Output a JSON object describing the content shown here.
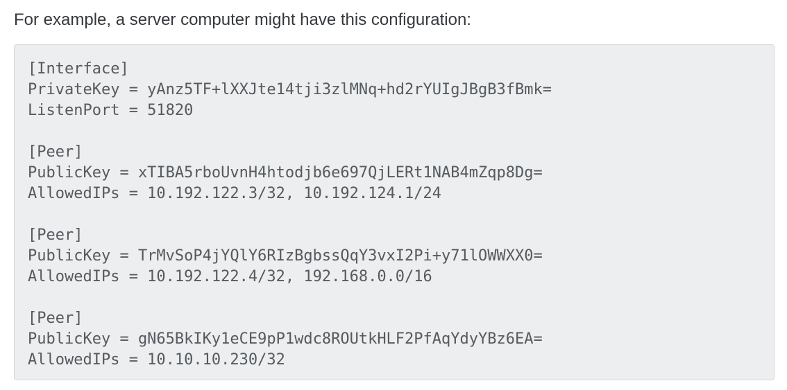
{
  "intro_text": "For example, a server computer might have this configuration:",
  "config": {
    "interface": {
      "header": "[Interface]",
      "lines": [
        "PrivateKey = yAnz5TF+lXXJte14tji3zlMNq+hd2rYUIgJBgB3fBmk=",
        "ListenPort = 51820"
      ]
    },
    "peers": [
      {
        "header": "[Peer]",
        "lines": [
          "PublicKey = xTIBA5rboUvnH4htodjb6e697QjLERt1NAB4mZqp8Dg=",
          "AllowedIPs = 10.192.122.3/32, 10.192.124.1/24"
        ]
      },
      {
        "header": "[Peer]",
        "lines": [
          "PublicKey = TrMvSoP4jYQlY6RIzBgbssQqY3vxI2Pi+y71lOWWXX0=",
          "AllowedIPs = 10.192.122.4/32, 192.168.0.0/16"
        ]
      },
      {
        "header": "[Peer]",
        "lines": [
          "PublicKey = gN65BkIKy1eCE9pP1wdc8ROUtkHLF2PfAqYdyYBz6EA=",
          "AllowedIPs = 10.10.10.230/32"
        ]
      }
    ]
  }
}
